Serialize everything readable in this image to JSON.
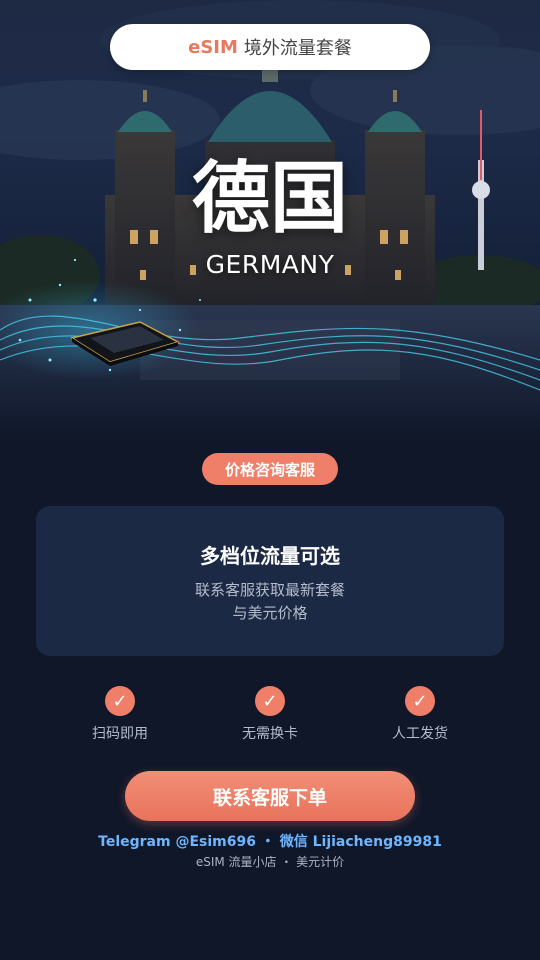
{
  "header": {
    "brand": "eSIM",
    "title": "境外流量套餐"
  },
  "hero": {
    "country_cn": "德国",
    "country_en": "GERMANY",
    "image": "berlin-cathedral-night-with-tv-tower-and-esim-chip"
  },
  "consult_badge": "价格咨询客服",
  "card": {
    "title": "多档位流量可选",
    "line1": "联系客服获取最新套餐",
    "line2": "与美元价格"
  },
  "features": [
    {
      "icon": "check-icon",
      "label": "扫码即用"
    },
    {
      "icon": "check-icon",
      "label": "无需换卡"
    },
    {
      "icon": "check-icon",
      "label": "人工发货"
    }
  ],
  "order_button": "联系客服下单",
  "contact_line": "Telegram @Esim696 ・ 微信 Lijiacheng89981",
  "footer_note": "eSIM 流量小店 ・ 美元计价",
  "colors": {
    "accent": "#ef7f68",
    "background": "#0f1729",
    "card": "#1c2944",
    "link": "#6fb6ff"
  }
}
